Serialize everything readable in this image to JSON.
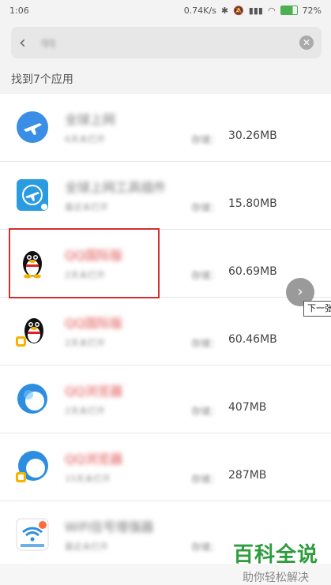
{
  "status": {
    "time": "1:06",
    "speed": "0.74K/s",
    "battery": "72%"
  },
  "search": {
    "query": "qq",
    "placeholder": ""
  },
  "results": {
    "count_label": "找到7个应用"
  },
  "apps": [
    {
      "name": "全球上网",
      "sub": "6天未打开",
      "storage_label": "存储：",
      "size": "30.26MB"
    },
    {
      "name": "全球上网工具插件",
      "sub": "最近未打开",
      "storage_label": "存储：",
      "size": "15.80MB"
    },
    {
      "name": "QQ国际版",
      "sub": "2天未打开",
      "storage_label": "存储：",
      "size": "60.69MB"
    },
    {
      "name": "QQ国际版",
      "sub": "2天未打开",
      "storage_label": "存储：",
      "size": "60.46MB"
    },
    {
      "name": "QQ浏览器",
      "sub": "2天未打开",
      "storage_label": "存储：",
      "size": "407MB"
    },
    {
      "name": "QQ浏览器",
      "sub": "15天未打开",
      "storage_label": "存储：",
      "size": "287MB"
    },
    {
      "name": "WiFi信号增强器",
      "sub": "最近未打开",
      "storage_label": "存储：",
      "size": ""
    }
  ],
  "next_tip": "下一张",
  "watermark": {
    "title": "百科全说",
    "subtitle": "助你轻松解决"
  },
  "colors": {
    "highlight": "#d03030",
    "watermark": "#2c9c3c",
    "airplane_blue": "#3a8ee6"
  }
}
